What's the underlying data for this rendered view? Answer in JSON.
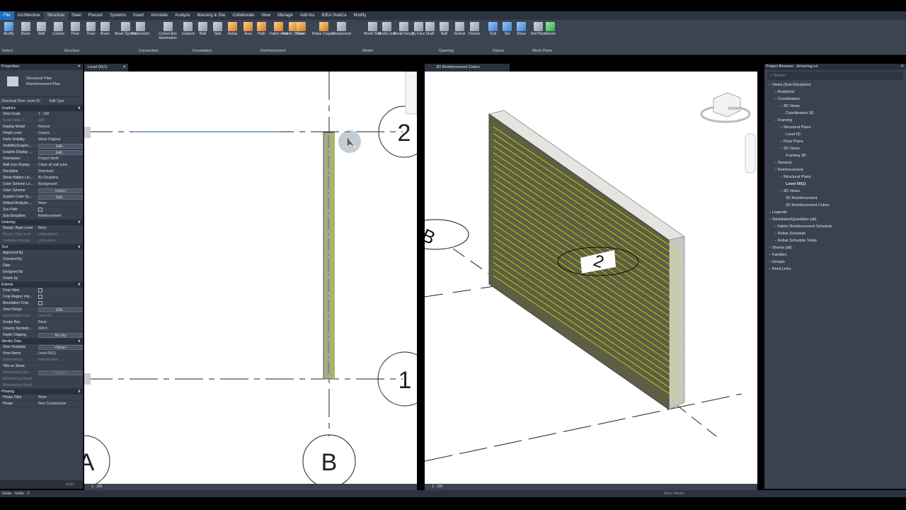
{
  "menu_tabs": [
    "File",
    "Architecture",
    "Structure",
    "Steel",
    "Precast",
    "Systems",
    "Insert",
    "Annotate",
    "Analyze",
    "Massing & Site",
    "Collaborate",
    "View",
    "Manage",
    "Add-Ins",
    "IDEA StatiCa",
    "Modify"
  ],
  "ribbon": {
    "tools": [
      "Modify",
      "Beam",
      "Wall",
      "Column",
      "Floor",
      "Truss",
      "Brace",
      "Beam System",
      "Connection",
      "Connection Automation",
      "Isolated",
      "Wall",
      "Slab",
      "Rebar",
      "Area",
      "Path",
      "Fabric Area",
      "Fabric Sheet",
      "Cover",
      "Rebar Coupler",
      "Component",
      "Model Text",
      "Model Line",
      "Model Group",
      "By Face",
      "Shaft",
      "Wall",
      "Vertical",
      "Dormer",
      "Grid",
      "Set",
      "Show",
      "Ref Plane",
      "Viewer"
    ],
    "panels": [
      "Select",
      "Structure",
      "Connection",
      "Foundation",
      "Reinforcement",
      "Model",
      "Opening",
      "Datum",
      "Work Plane"
    ]
  },
  "properties": {
    "title": "Properties",
    "type_name": "Structural Plan",
    "type_sub": "Reinforcement Plan",
    "selector": "Structural Plan: Level 0C",
    "edit_type": "Edit Type",
    "sections": [
      {
        "name": "Graphics",
        "rows": [
          [
            "View Scale",
            "1 : 100"
          ],
          [
            "Scale Value 1:",
            "100"
          ],
          [
            "Display Model",
            "Normal"
          ],
          [
            "Detail Level",
            "Coarse"
          ],
          [
            "Parts Visibility",
            "Show Original"
          ],
          [
            "Visibility/Graphic...",
            "Edit..."
          ],
          [
            "Graphic Display ...",
            "Edit..."
          ],
          [
            "Orientation",
            "Project North"
          ],
          [
            "Wall Join Display",
            "Clean all wall joins"
          ],
          [
            "Discipline",
            "Structural"
          ],
          [
            "Show Hidden Lin...",
            "By Discipline"
          ],
          [
            "Color Scheme Lo...",
            "Background"
          ],
          [
            "Color Scheme",
            "<none>"
          ],
          [
            "System Color Sc...",
            "Edit..."
          ],
          [
            "Default Analysis ...",
            "None"
          ],
          [
            "Sun Path",
            ""
          ],
          [
            "Sub-Discipline",
            "Reinforcement"
          ]
        ]
      },
      {
        "name": "Underlay",
        "rows": [
          [
            "Range: Base Level",
            "None"
          ],
          [
            "Range: Top Level",
            "Unbounded"
          ],
          [
            "Underlay Orienta...",
            "Look down"
          ]
        ]
      },
      {
        "name": "Text",
        "rows": [
          [
            "Approved By",
            ""
          ],
          [
            "Checked By",
            ""
          ],
          [
            "Date",
            ""
          ],
          [
            "Designed By",
            ""
          ],
          [
            "Drawn by",
            ""
          ]
        ]
      },
      {
        "name": "Extents",
        "rows": [
          [
            "Crop View",
            ""
          ],
          [
            "Crop Region Visi...",
            ""
          ],
          [
            "Annotation Crop",
            ""
          ],
          [
            "View Range",
            "Edit..."
          ],
          [
            "Associated Level",
            "Level 00"
          ],
          [
            "Scope Box",
            "None"
          ],
          [
            "Column Symboli...",
            "304.8"
          ],
          [
            "Depth Clipping",
            "No clip"
          ]
        ]
      },
      {
        "name": "Identity Data",
        "rows": [
          [
            "View Template",
            "<None>"
          ],
          [
            "View Name",
            "Level 00(1)"
          ],
          [
            "Dependency",
            "Independent"
          ],
          [
            "Title on Sheet",
            ""
          ],
          [
            "Referencing She...",
            "<None>"
          ],
          [
            "Referencing Sheet",
            ""
          ],
          [
            "Referencing Detail",
            ""
          ]
        ]
      },
      {
        "name": "Phasing",
        "rows": [
          [
            "Phase Filter",
            "None"
          ],
          [
            "Phase",
            "New Construction"
          ]
        ]
      }
    ],
    "apply": "Apply"
  },
  "view_left": {
    "tab": "Level 00(1)",
    "scale": "1 : 100",
    "grid_labels": [
      "2",
      "1",
      "A",
      "B"
    ]
  },
  "view_right": {
    "tab": "3D Reinforcement Colors",
    "scale": "1 : 100",
    "grid_labels": [
      "B",
      "2"
    ],
    "viewcube": "FRONT"
  },
  "browser": {
    "title": "Project Browser - Armering.rvt",
    "search": "Search",
    "items": [
      {
        "t": "Views (Sub-Discipline)",
        "d": 0
      },
      {
        "t": "Analytical",
        "d": 1
      },
      {
        "t": "Coordination",
        "d": 1
      },
      {
        "t": "3D Views",
        "d": 2
      },
      {
        "t": "Coordination 3D",
        "d": 3
      },
      {
        "t": "Framing",
        "d": 1
      },
      {
        "t": "Structural Plans",
        "d": 2
      },
      {
        "t": "Level 00",
        "d": 3
      },
      {
        "t": "Floor Plans",
        "d": 2
      },
      {
        "t": "3D Views",
        "d": 2
      },
      {
        "t": "Framing 3D",
        "d": 3
      },
      {
        "t": "General",
        "d": 1
      },
      {
        "t": "Reinforcement",
        "d": 1
      },
      {
        "t": "Structural Plans",
        "d": 2
      },
      {
        "t": "Level 00(1)",
        "d": 3,
        "b": true
      },
      {
        "t": "3D Views",
        "d": 2
      },
      {
        "t": "3D Reinforcement",
        "d": 3
      },
      {
        "t": "3D Reinforcement Colors",
        "d": 3
      },
      {
        "t": "Legends",
        "d": 0
      },
      {
        "t": "Schedules/Quantities (all)",
        "d": 0
      },
      {
        "t": "Fabric Reinforcement Schedule",
        "d": 1
      },
      {
        "t": "Rebar Schedule",
        "d": 1
      },
      {
        "t": "Rebar Schedule Totals",
        "d": 1
      },
      {
        "t": "Sheets (all)",
        "d": 0
      },
      {
        "t": "Families",
        "d": 0
      },
      {
        "t": "Groups",
        "d": 0
      },
      {
        "t": "Revit Links",
        "d": 0
      }
    ]
  },
  "status": {
    "left": "Grids : Grids : 2",
    "model": "Main Model"
  }
}
